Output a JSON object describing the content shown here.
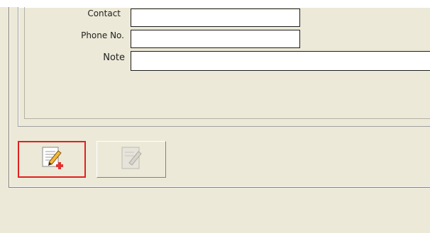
{
  "form": {
    "fields": [
      {
        "label": "Contact",
        "value": ""
      },
      {
        "label": "Phone No.",
        "value": ""
      },
      {
        "label": "Note",
        "value": ""
      }
    ]
  },
  "toolbar": {
    "new_icon": "edit-add-icon",
    "edit_icon": "edit-disabled-icon"
  },
  "colors": {
    "background": "#ece9d8",
    "highlight_border": "#e02020"
  }
}
